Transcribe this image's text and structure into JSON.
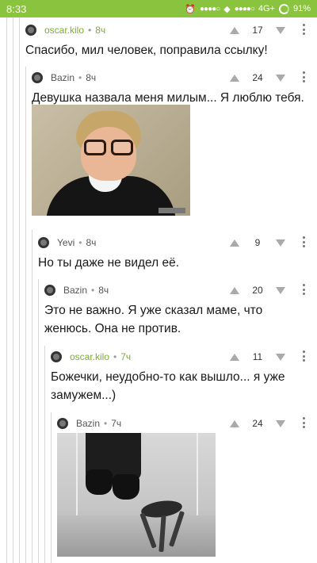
{
  "status_bar": {
    "time": "8:33",
    "signal1": "●●●●○",
    "signal2": "●●●●○",
    "network": "4G+",
    "battery": "91%"
  },
  "colors": {
    "accent": "#8ac43f",
    "username_green": "#7ab030"
  },
  "comments": [
    {
      "username": "oscar.kilo",
      "time": "8ч",
      "score": "17",
      "text": "Спасибо, мил человек, поправила ссылку!"
    },
    {
      "username": "Bazin",
      "time": "8ч",
      "score": "24",
      "text": "Девушка назвала меня милым... Я люблю тебя."
    },
    {
      "username": "Yevi",
      "time": "8ч",
      "score": "9",
      "text": "Но ты даже не видел её."
    },
    {
      "username": "Bazin",
      "time": "8ч",
      "score": "20",
      "text": "Это не важно. Я уже сказал маме, что женюсь. Она не против."
    },
    {
      "username": "oscar.kilo",
      "time": "7ч",
      "score": "11",
      "text": "Божечки, неудобно-то как вышло... я уже замужем...)"
    },
    {
      "username": "Bazin",
      "time": "7ч",
      "score": "24",
      "text": ""
    }
  ],
  "icons": {
    "upvote": "upvote-icon",
    "downvote": "downvote-icon",
    "more": "more-options-icon"
  }
}
